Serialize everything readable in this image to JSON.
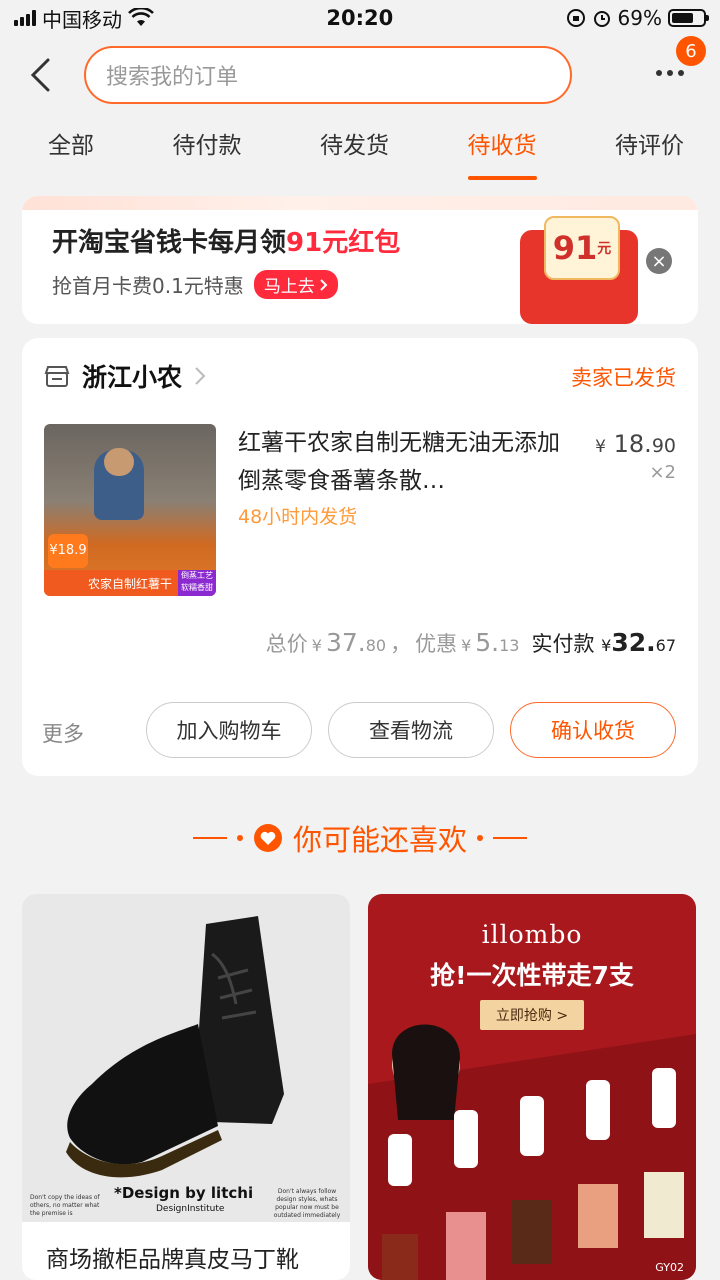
{
  "status_bar": {
    "carrier": "中国移动",
    "time": "20:20",
    "battery": "69%",
    "battery_level": 0.69
  },
  "header": {
    "search_placeholder": "搜索我的订单",
    "message_count": "6"
  },
  "tabs": [
    {
      "label": "全部",
      "active": false
    },
    {
      "label": "待付款",
      "active": false
    },
    {
      "label": "待发货",
      "active": false
    },
    {
      "label": "待收货",
      "active": true
    },
    {
      "label": "待评价",
      "active": false
    }
  ],
  "promo": {
    "title_prefix": "开淘宝省钱卡每月领",
    "title_highlight": "91元红包",
    "subtitle": "抢首月卡费0.1元特惠",
    "go_label": "马上去",
    "amount": "91",
    "amount_unit": "元"
  },
  "order": {
    "shop_name": "浙江小农",
    "status": "卖家已发货",
    "item": {
      "title": "红薯干农家自制无糖无油无添加倒蒸零食番薯条散…",
      "ship_note": "48小时内发货",
      "price_currency": "¥",
      "price_int": "18.",
      "price_dec": "90",
      "quantity": "×2",
      "thumb_caption": "农家自制红薯干",
      "thumb_badge_price": "¥18.9",
      "thumb_tag": "倒蒸工艺 软糯香甜"
    },
    "totals": {
      "total_label": "总价",
      "total_cur": "¥",
      "total_int": "37.",
      "total_dec": "80",
      "sep": "，",
      "discount_label": "优惠",
      "discount_cur": "¥",
      "discount_int": "5.",
      "discount_dec": "13",
      "paid_label": "实付款",
      "paid_cur": "¥",
      "paid_int": "32.",
      "paid_dec": "67"
    },
    "more_label": "更多",
    "buttons": {
      "cart": "加入购物车",
      "logistics": "查看物流",
      "confirm": "确认收货"
    }
  },
  "recommend": {
    "title": "你可能还喜欢",
    "products": [
      {
        "title": "商场撤柜品牌真皮马丁靴",
        "image_caption": "*Design by litchi",
        "image_subcaption": "DesignInstitute",
        "image_note_left": "Don't copy the ideas of others, no matter what the premise is",
        "image_note_right": "Don't always follow design styles, whats popular now must be outdated immediately"
      },
      {
        "brand": "illombo",
        "headline": "抢!一次性带走7支",
        "cta": "立即抢购 >",
        "code": "GY02"
      }
    ]
  },
  "colors": {
    "accent": "#ff5500",
    "promo_red": "#ff2a3c",
    "ship_note": "#ff9a3b"
  }
}
